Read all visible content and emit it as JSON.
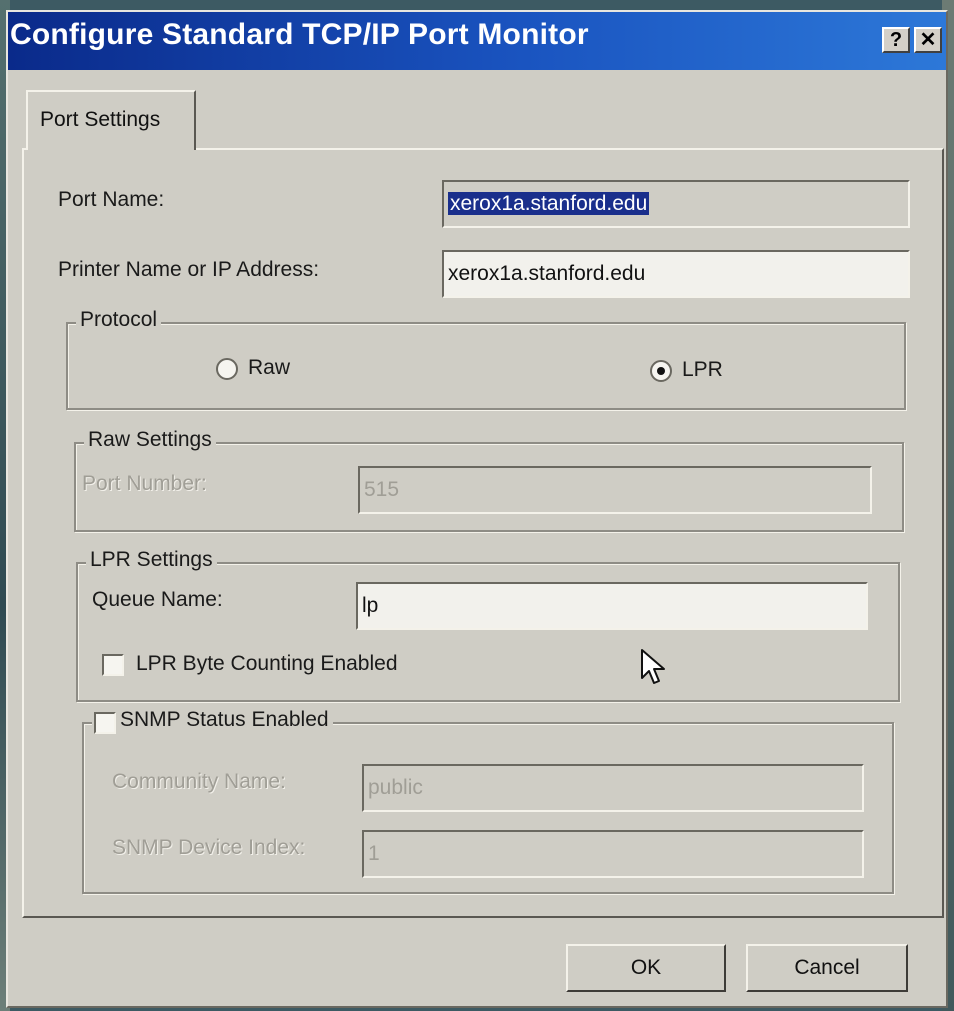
{
  "window": {
    "title": "Configure Standard TCP/IP Port Monitor",
    "help_label": "?",
    "close_label": "✕"
  },
  "tabs": [
    {
      "label": "Port Settings",
      "selected": true
    }
  ],
  "port_name": {
    "label": "Port Name:",
    "value": "xerox1a.stanford.edu"
  },
  "printer_address": {
    "label": "Printer Name or IP Address:",
    "value": "xerox1a.stanford.edu"
  },
  "protocol": {
    "legend": "Protocol",
    "options": [
      {
        "label": "Raw",
        "selected": false
      },
      {
        "label": "LPR",
        "selected": true
      }
    ]
  },
  "raw_settings": {
    "legend": "Raw Settings",
    "port_number_label": "Port Number:",
    "port_number_value": "515"
  },
  "lpr_settings": {
    "legend": "LPR Settings",
    "queue_name_label": "Queue Name:",
    "queue_name_value": "lp",
    "byte_counting_label": "LPR Byte Counting Enabled",
    "byte_counting_checked": false
  },
  "snmp": {
    "label": "SNMP Status Enabled",
    "checked": false,
    "community_name_label": "Community Name:",
    "community_name_value": "public",
    "device_index_label": "SNMP Device Index:",
    "device_index_value": "1"
  },
  "buttons": {
    "ok": "OK",
    "cancel": "Cancel"
  },
  "icons": {
    "cursor": "mouse-pointer-icon"
  }
}
